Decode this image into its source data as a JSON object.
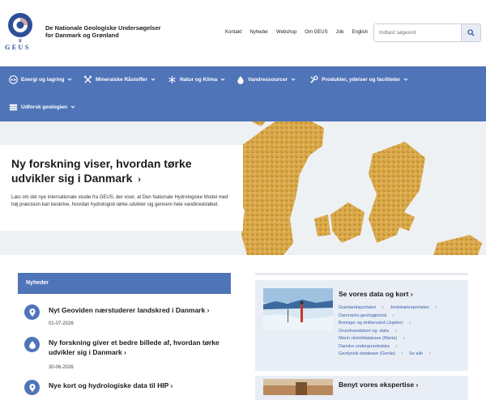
{
  "header": {
    "logo_wordmark": "GEUS",
    "org_line1": "De Nationale Geologiske Undersøgelser",
    "org_line2": "for Danmark og Grønland",
    "topnav": [
      "Kontakt",
      "Nyheder",
      "Webshop",
      "Om GEUS",
      "Job",
      "English"
    ],
    "search_placeholder": "Indtast søgeord"
  },
  "mainnav": {
    "items": [
      {
        "label": "Energi og lagring",
        "icon": "energy-icon"
      },
      {
        "label": "Mineralske Råstoffer",
        "icon": "pickaxe-icon"
      },
      {
        "label": "Natur og Klima",
        "icon": "snowflake-icon"
      },
      {
        "label": "Vandressourcer",
        "icon": "water-drop-icon"
      },
      {
        "label": "Produkter, ydelser og faciliteter",
        "icon": "tools-icon"
      },
      {
        "label": "Udforsk geologien",
        "icon": "layers-icon"
      }
    ]
  },
  "hero": {
    "title": "Ny forskning viser, hvordan tørke udvikler sig i Danmark",
    "text": "Læs om det nye internationale studie fra GEUS, der viser, at Den Nationale Hydrologiske Model med høj præcision kan beskrive, hvordan hydrologisk tørke udvikler sig gennem hele vandkredsløbet.",
    "slide_count": 5,
    "active_slide": 1
  },
  "news": {
    "heading": "Nyheder",
    "items": [
      {
        "title": "Nyt Geoviden nærstuderer landskred i Danmark",
        "date": "01-07-2026",
        "icon": "location-pin-icon"
      },
      {
        "title": "Ny forskning giver et bedre billede af, hvordan tørke udvikler sig i Danmark",
        "date": "30-06-2026",
        "icon": "water-drop-icon"
      },
      {
        "title": "Nye kort og hydrologiske data til HIP",
        "date": "",
        "icon": "location-pin-icon"
      }
    ]
  },
  "right": {
    "data_card": {
      "title": "Se vores data og kort",
      "links": [
        "Grønlandsportalen",
        "Jordskælvsportalen",
        "Danmarks geologiportal",
        "Boringer og drikkevand (Jupiter)",
        "Grundvandskort og -data",
        "Marin råstofdatabase (Marta)",
        "Danske undergrundsdata",
        "Geofysisk database (Gerda)",
        "Se alle"
      ]
    },
    "expert_card": {
      "title": "Benyt vores ekspertise"
    }
  },
  "colors": {
    "brand_blue": "#4f74b8",
    "link_blue": "#3d62a8",
    "card_bg": "#e9eef6"
  }
}
